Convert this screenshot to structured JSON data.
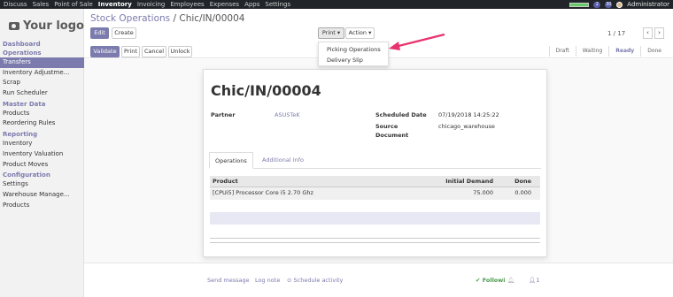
{
  "topbar": {
    "apps": [
      "Discuss",
      "Sales",
      "Point of Sale",
      "Inventory",
      "Invoicing",
      "Employees",
      "Expenses",
      "Apps",
      "Settings"
    ],
    "active_app": "Inventory",
    "messages_count": "2",
    "activity_count": "30",
    "user": "Administrator"
  },
  "sidebar": {
    "logo": "Your logo",
    "sections": [
      {
        "title": "Dashboard Operations",
        "items": []
      },
      {
        "title": "",
        "items": [
          "Transfers",
          "Inventory Adjustme...",
          "Scrap",
          "Run Scheduler"
        ]
      },
      {
        "title": "Master Data",
        "items": [
          "Products",
          "Reordering Rules"
        ]
      },
      {
        "title": "Reporting",
        "items": [
          "Inventory",
          "Inventory Valuation",
          "Product Moves"
        ]
      },
      {
        "title": "Configuration",
        "items": [
          "Settings",
          "Warehouse Manage...",
          "Products"
        ]
      }
    ],
    "labels": {
      "dash1": "Dashboard",
      "dash2": "Operations",
      "transfers": "Transfers",
      "inv_adj": "Inventory Adjustme...",
      "scrap": "Scrap",
      "run_sched": "Run Scheduler",
      "master": "Master Data",
      "products": "Products",
      "reorder": "Reordering Rules",
      "reporting": "Reporting",
      "inventory": "Inventory",
      "inv_val": "Inventory Valuation",
      "moves": "Product Moves",
      "config": "Configuration",
      "settings": "Settings",
      "wh_manage": "Warehouse Manage...",
      "products2": "Products"
    }
  },
  "breadcrumb": {
    "parent": "Stock Operations",
    "sep": "/",
    "current": "Chic/IN/00004"
  },
  "buttons": {
    "edit": "Edit",
    "create": "Create",
    "print": "Print ▾",
    "action": "Action ▾",
    "validate": "Validate",
    "print2": "Print",
    "cancel": "Cancel",
    "unlock": "Unlock"
  },
  "pager": {
    "value": "1 / 17",
    "prev": "‹",
    "next": "›"
  },
  "print_menu": {
    "options": [
      "Picking Operations",
      "Delivery Slip"
    ]
  },
  "stages": [
    "Draft",
    "Waiting",
    "Ready",
    "Done"
  ],
  "current_stage": "Ready",
  "form": {
    "name": "Chic/IN/00004",
    "partner_label": "Partner",
    "partner": "ASUSTeK",
    "scheduled_label": "Scheduled Date",
    "scheduled": "07/19/2018 14:25:22",
    "source_label1": "Source",
    "source_label2": "Document",
    "source": "chicago_warehouse",
    "tabs": [
      "Operations",
      "Additional Info"
    ],
    "columns": [
      "Product",
      "Initial Demand",
      "Done"
    ],
    "rows": [
      {
        "product": "[CPUi5] Processor Core i5 2.70 Ghz",
        "demand": "75.000",
        "done": "0.000"
      }
    ]
  },
  "chatter": {
    "send": "Send message",
    "log": "Log note",
    "schedule": "⊙ Schedule activity",
    "following": "✔ Followi",
    "followers": "1"
  },
  "colors": {
    "accent": "#7c7bad",
    "topbar": "#212529",
    "arrow": "#e8336e"
  }
}
